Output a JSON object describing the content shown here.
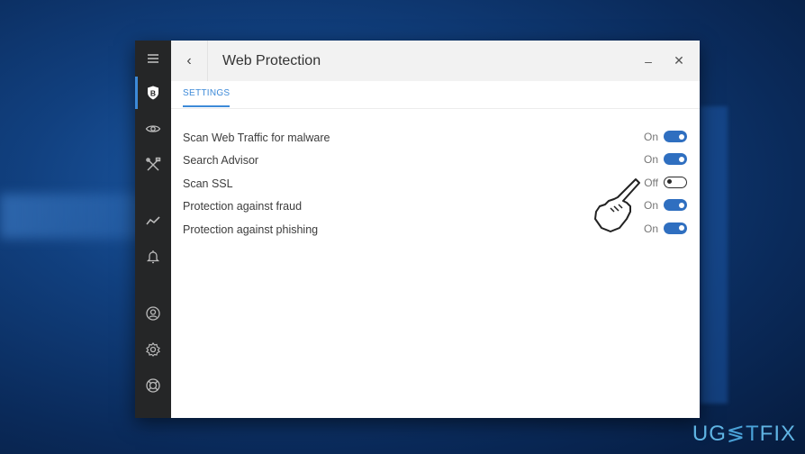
{
  "window": {
    "title": "Web Protection",
    "back_label": "‹",
    "minimize_label": "–",
    "close_label": "✕"
  },
  "rail": {
    "items": [
      {
        "icon": "hamburger-menu-icon",
        "active": false
      },
      {
        "icon": "shield-b-icon",
        "active": true
      },
      {
        "icon": "eye-icon",
        "active": false
      },
      {
        "icon": "tools-icon",
        "active": false
      },
      {
        "icon": "activity-graph-icon",
        "active": false
      },
      {
        "icon": "bell-icon",
        "active": false
      },
      {
        "icon": "user-account-icon",
        "active": false
      },
      {
        "icon": "gear-icon",
        "active": false
      },
      {
        "icon": "lifebuoy-support-icon",
        "active": false
      }
    ]
  },
  "tabs": [
    {
      "label": "SETTINGS",
      "active": true
    }
  ],
  "settings": [
    {
      "label": "Scan Web Traffic for malware",
      "state": "On",
      "enabled": true
    },
    {
      "label": "Search Advisor",
      "state": "On",
      "enabled": true
    },
    {
      "label": "Scan SSL",
      "state": "Off",
      "enabled": false
    },
    {
      "label": "Protection against fraud",
      "state": "On",
      "enabled": true
    },
    {
      "label": "Protection against phishing",
      "state": "On",
      "enabled": true
    }
  ],
  "colors": {
    "accent": "#3d8ad8",
    "toggle_on": "#2f6fc0",
    "rail_bg": "#252627"
  },
  "watermark": {
    "part1": "UG",
    "part2": "≶T",
    "part3": "FIX"
  }
}
